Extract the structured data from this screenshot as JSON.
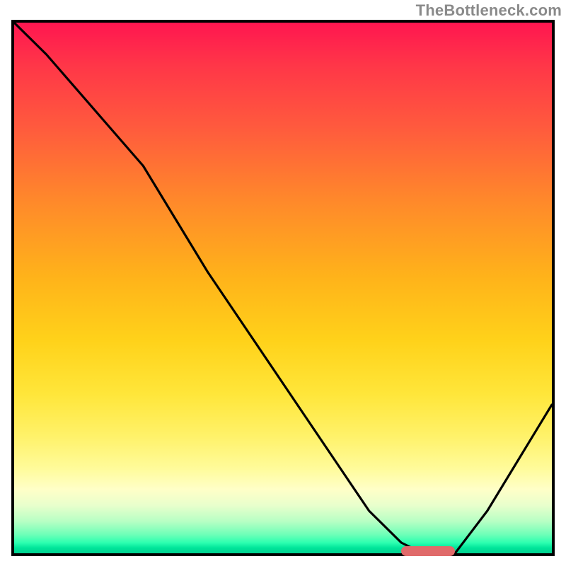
{
  "watermark": "TheBottleneck.com",
  "colors": {
    "frame": "#000000",
    "line": "#000000",
    "marker": "#e06a6a"
  },
  "chart_data": {
    "type": "line",
    "title": "",
    "xlabel": "",
    "ylabel": "",
    "xlim": [
      0,
      100
    ],
    "ylim": [
      0,
      100
    ],
    "grid": false,
    "x": [
      0,
      6,
      12,
      18,
      24,
      30,
      36,
      42,
      48,
      54,
      60,
      66,
      72,
      76,
      82,
      88,
      94,
      100
    ],
    "values": [
      100,
      94,
      87,
      80,
      73,
      63,
      53,
      44,
      35,
      26,
      17,
      8,
      2,
      0,
      0,
      8,
      18,
      28
    ],
    "marker_band": {
      "x_start": 72,
      "x_end": 82,
      "y": 0
    },
    "gradient_stops": [
      {
        "pct": 0,
        "color": "#ff1650"
      },
      {
        "pct": 8,
        "color": "#ff3648"
      },
      {
        "pct": 20,
        "color": "#ff5b3d"
      },
      {
        "pct": 34,
        "color": "#ff8a2a"
      },
      {
        "pct": 48,
        "color": "#ffb31a"
      },
      {
        "pct": 60,
        "color": "#ffd21a"
      },
      {
        "pct": 70,
        "color": "#ffe63a"
      },
      {
        "pct": 78,
        "color": "#fff26a"
      },
      {
        "pct": 84,
        "color": "#fffb9a"
      },
      {
        "pct": 88,
        "color": "#ffffc8"
      },
      {
        "pct": 91,
        "color": "#e8ffcc"
      },
      {
        "pct": 94,
        "color": "#b7ffc4"
      },
      {
        "pct": 96.5,
        "color": "#6dffb8"
      },
      {
        "pct": 98,
        "color": "#2dffb0"
      },
      {
        "pct": 99,
        "color": "#00e59a"
      },
      {
        "pct": 100,
        "color": "#00d190"
      }
    ]
  }
}
